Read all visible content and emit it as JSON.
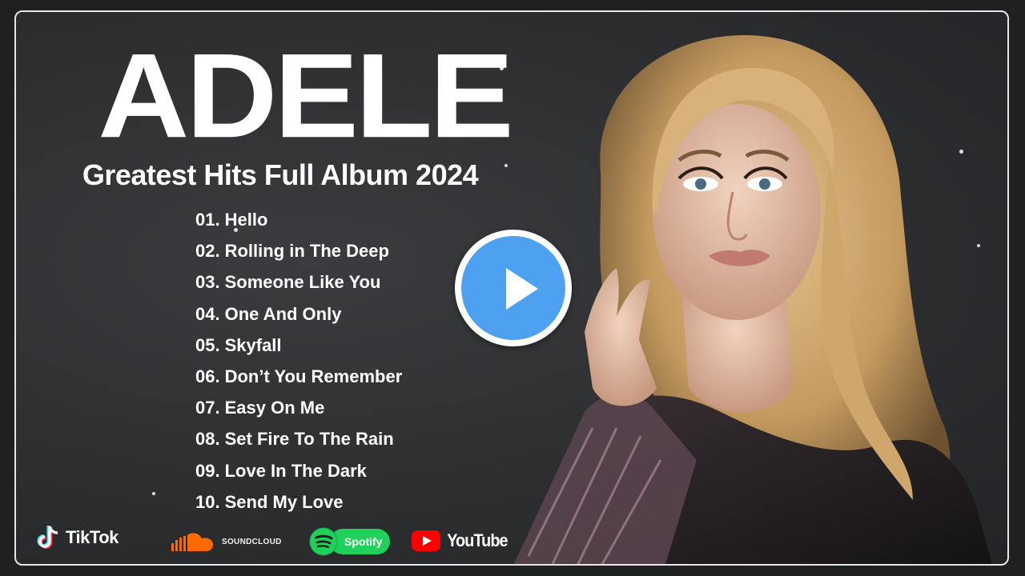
{
  "artist": "ADELE",
  "subtitle": "Greatest Hits Full Album 2024",
  "tracks": [
    {
      "num": "01.",
      "title": "Hello"
    },
    {
      "num": "02.",
      "title": "Rolling in The Deep"
    },
    {
      "num": "03.",
      "title": "Someone Like You"
    },
    {
      "num": "04.",
      "title": "One And Only"
    },
    {
      "num": "05.",
      "title": "Skyfall"
    },
    {
      "num": "06.",
      "title": "Don’t You Remember"
    },
    {
      "num": "07.",
      "title": "Easy On Me"
    },
    {
      "num": "08.",
      "title": "Set Fire To The Rain"
    },
    {
      "num": "09.",
      "title": "Love In The Dark"
    },
    {
      "num": "10.",
      "title": "Send My Love"
    }
  ],
  "play_button": {
    "icon": "play-icon",
    "color": "#4ea1f0"
  },
  "platforms": {
    "tiktok": {
      "label": "TikTok",
      "icon": "tiktok-icon"
    },
    "soundcloud": {
      "label": "SOUNDCLOUD",
      "icon": "soundcloud-icon",
      "color": "#ff6a00"
    },
    "spotify": {
      "label": "Spotify",
      "icon": "spotify-icon",
      "color": "#1fd05a"
    },
    "youtube": {
      "label": "YouTube",
      "icon": "youtube-icon",
      "color": "#ff0000"
    }
  }
}
